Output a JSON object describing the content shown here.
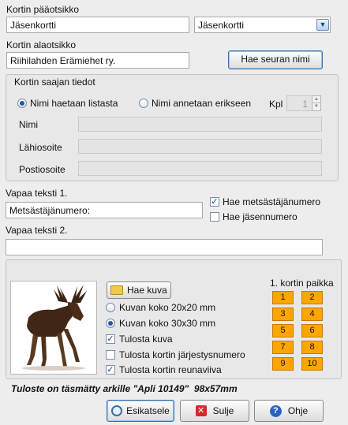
{
  "header": {
    "title_label": "Kortin pääotsikko",
    "title_value": "Jäsenkortti",
    "title_select_value": "Jäsenkortti",
    "subtitle_label": "Kortin alaotsikko",
    "subtitle_value": "Riihilahden Erämiehet ry.",
    "fetch_club_button": "Hae seuran nimi"
  },
  "recipient": {
    "group_title": "Kortin saajan tiedot",
    "radio_list": "Nimi haetaan listasta",
    "radio_manual": "Nimi annetaan erikseen",
    "count_label": "Kpl",
    "count_value": "1",
    "name_label": "Nimi",
    "address_label": "Lähiosoite",
    "postal_label": "Postiosoite"
  },
  "free_text": {
    "label1": "Vapaa teksti 1.",
    "value1": "Metsästäjänumero:",
    "label2": "Vapaa teksti 2.",
    "value2": "",
    "chk_hunter_number": "Hae metsästäjänumero",
    "chk_member_number": "Hae jäsennumero"
  },
  "image_options": {
    "fetch_image_button": "Hae kuva",
    "size_20": "Kuvan koko 20x20 mm",
    "size_30": "Kuvan koko 30x30 mm",
    "print_image": "Tulosta kuva",
    "print_order_number": "Tulosta kortin järjestysnumero",
    "print_border": "Tulosta kortin reunaviiva",
    "position_title": "1. kortin paikka",
    "positions": [
      "1",
      "2",
      "3",
      "4",
      "5",
      "6",
      "7",
      "8",
      "9",
      "10"
    ]
  },
  "footer": {
    "note": "Tuloste on täsmätty arkille \"Apli 10149\"  98x57mm",
    "preview_button": "Esikatsele",
    "close_button": "Sulje",
    "help_button": "Ohje"
  },
  "colors": {
    "position_cell": "#ffa500",
    "background": "#ededed"
  }
}
